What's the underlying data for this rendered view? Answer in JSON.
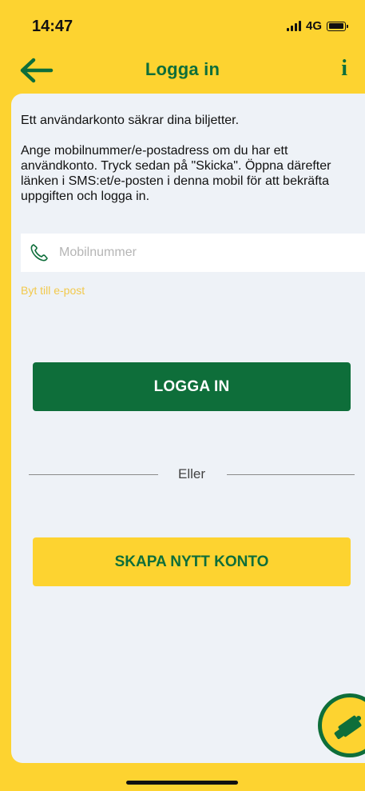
{
  "status_bar": {
    "time": "14:47",
    "network": "4G"
  },
  "nav": {
    "title": "Logga in",
    "info_label": "i",
    "back_icon": "arrow-left-icon"
  },
  "content": {
    "intro_text": "Ett användarkonto säkrar dina biljetter.",
    "instructions": "Ange mobilnummer/e-postadress om du har ett användkonto. Tryck sedan på \"Skicka\". Öppna därefter länken i SMS:et/e-posten i denna mobil för att bekräfta uppgiften och logga in.",
    "phone_placeholder": "Mobilnummer",
    "phone_value": "",
    "switch_link": "Byt till e-post",
    "login_button": "LOGGA IN",
    "or_text": "Eller",
    "create_account_button": "SKAPA NYTT KONTO"
  },
  "icons": {
    "phone": "phone-icon",
    "fab": "ticket-icon"
  },
  "colors": {
    "brand_yellow": "#FDD330",
    "brand_green": "#0E6E3A",
    "background": "#EEF2F7",
    "link": "#F2C94C"
  }
}
